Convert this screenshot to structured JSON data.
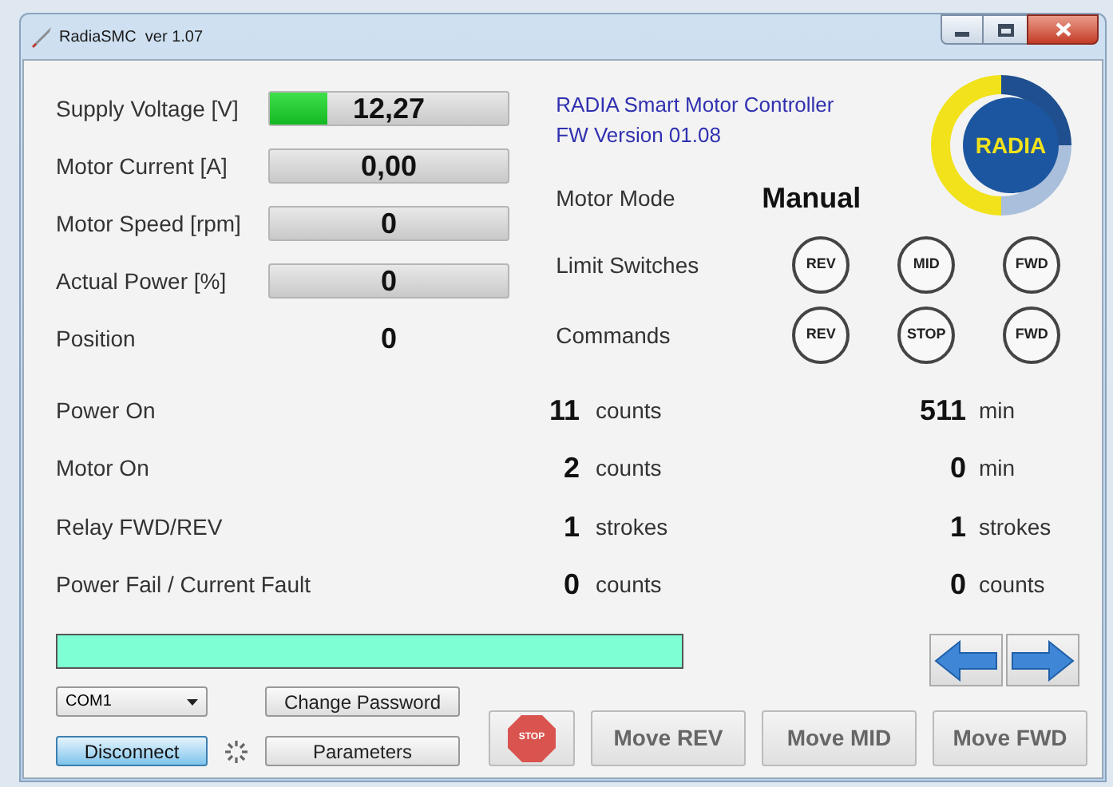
{
  "window": {
    "title": "RadiaSMC  ver 1.07"
  },
  "gauges": [
    {
      "label": "Supply Voltage [V]",
      "value": "12,27",
      "level": 0.24
    },
    {
      "label": "Motor Current [A]",
      "value": "0,00",
      "level": 0
    },
    {
      "label": "Motor Speed [rpm]",
      "value": "0",
      "level": 0
    },
    {
      "label": "Actual Power [%]",
      "value": "0",
      "level": 0
    }
  ],
  "position": {
    "label": "Position",
    "value": "0"
  },
  "device": {
    "name": "RADIA Smart Motor Controller",
    "firmware": "FW Version 01.08"
  },
  "logo": {
    "text": "RADIA"
  },
  "motor_mode": {
    "label": "Motor Mode",
    "value": "Manual"
  },
  "limit_switches": {
    "label": "Limit Switches",
    "indicators": [
      "REV",
      "MID",
      "FWD"
    ]
  },
  "commands": {
    "label": "Commands",
    "buttons": [
      "REV",
      "STOP",
      "FWD"
    ]
  },
  "counters": [
    {
      "label": "Power On",
      "value_1": "11",
      "unit_1": "counts",
      "value_2": "511",
      "unit_2": "min"
    },
    {
      "label": "Motor On",
      "value_1": "2",
      "unit_1": "counts",
      "value_2": "0",
      "unit_2": "min"
    },
    {
      "label": "Relay FWD/REV",
      "value_1": "1",
      "unit_1": "strokes",
      "value_2": "1",
      "unit_2": "strokes"
    },
    {
      "label": "Power Fail / Current Fault",
      "value_1": "0",
      "unit_1": "counts",
      "value_2": "0",
      "unit_2": "counts"
    }
  ],
  "progress": {
    "level": 1
  },
  "port": {
    "value": "COM1"
  },
  "connect_button": "Disconnect",
  "change_password_button": "Change Password",
  "parameters_button": "Parameters",
  "stop_button": "STOP",
  "move_buttons": [
    "Move REV",
    "Move MID",
    "Move FWD"
  ]
}
